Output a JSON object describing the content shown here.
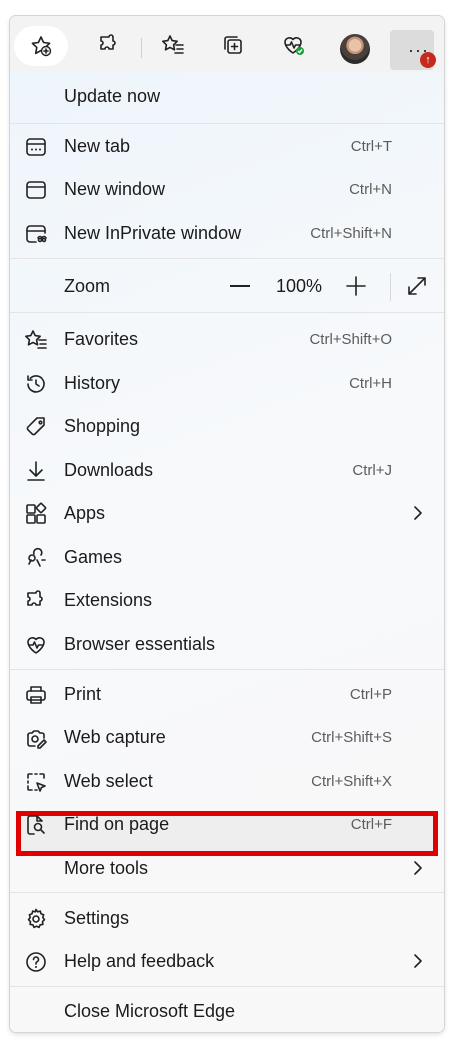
{
  "toolbar": {
    "icons": [
      "add-favorite-icon",
      "extensions-icon",
      "favorites-icon",
      "collections-icon",
      "browser-essentials-icon",
      "profile-avatar",
      "more-menu-icon"
    ],
    "more_label": "···",
    "badge": "↑"
  },
  "menu": {
    "update_now": "Update now",
    "new_tab": {
      "label": "New tab",
      "shortcut": "Ctrl+T"
    },
    "new_window": {
      "label": "New window",
      "shortcut": "Ctrl+N"
    },
    "new_inprivate": {
      "label": "New InPrivate window",
      "shortcut": "Ctrl+Shift+N"
    },
    "zoom": {
      "label": "Zoom",
      "minus": "—",
      "value": "100%",
      "plus": "+"
    },
    "favorites": {
      "label": "Favorites",
      "shortcut": "Ctrl+Shift+O"
    },
    "history": {
      "label": "History",
      "shortcut": "Ctrl+H"
    },
    "shopping": {
      "label": "Shopping"
    },
    "downloads": {
      "label": "Downloads",
      "shortcut": "Ctrl+J"
    },
    "apps": {
      "label": "Apps"
    },
    "games": {
      "label": "Games"
    },
    "extensions": {
      "label": "Extensions"
    },
    "browser_essentials": {
      "label": "Browser essentials"
    },
    "print": {
      "label": "Print",
      "shortcut": "Ctrl+P"
    },
    "web_capture": {
      "label": "Web capture",
      "shortcut": "Ctrl+Shift+S"
    },
    "web_select": {
      "label": "Web select",
      "shortcut": "Ctrl+Shift+X"
    },
    "find_on_page": {
      "label": "Find on page",
      "shortcut": "Ctrl+F"
    },
    "more_tools": {
      "label": "More tools"
    },
    "settings": {
      "label": "Settings"
    },
    "help_feedback": {
      "label": "Help and feedback"
    },
    "close_edge": {
      "label": "Close Microsoft Edge"
    }
  },
  "colors": {
    "highlight": "#e00000",
    "badge": "#c42b1c"
  }
}
